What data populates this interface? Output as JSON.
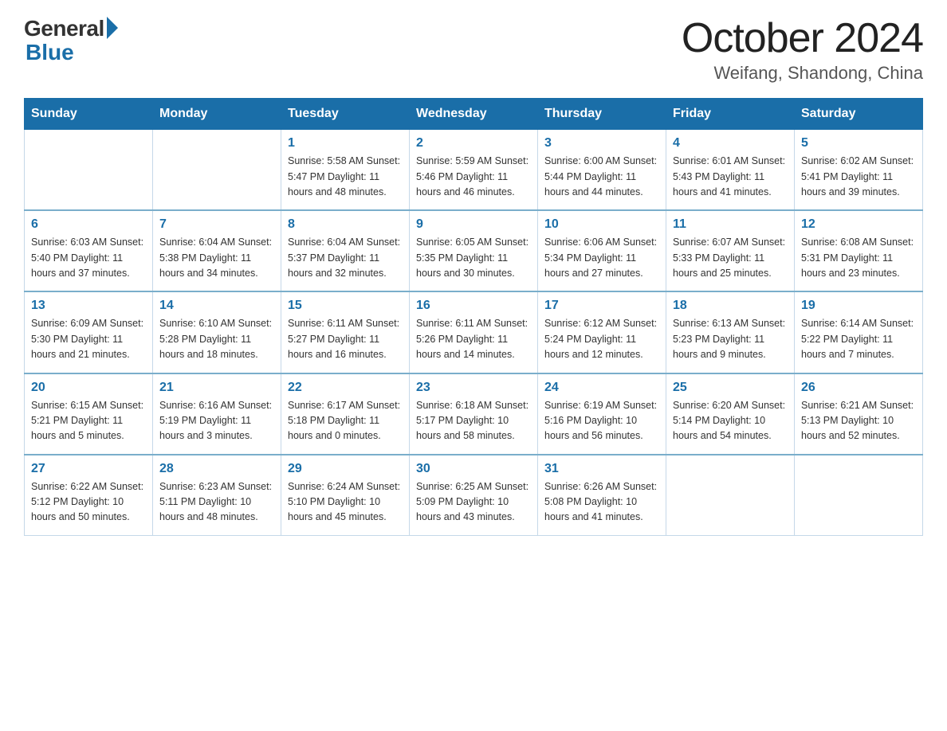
{
  "header": {
    "logo_general": "General",
    "logo_blue": "Blue",
    "month_title": "October 2024",
    "location": "Weifang, Shandong, China"
  },
  "calendar": {
    "days_of_week": [
      "Sunday",
      "Monday",
      "Tuesday",
      "Wednesday",
      "Thursday",
      "Friday",
      "Saturday"
    ],
    "weeks": [
      [
        {
          "day": "",
          "info": ""
        },
        {
          "day": "",
          "info": ""
        },
        {
          "day": "1",
          "info": "Sunrise: 5:58 AM\nSunset: 5:47 PM\nDaylight: 11 hours\nand 48 minutes."
        },
        {
          "day": "2",
          "info": "Sunrise: 5:59 AM\nSunset: 5:46 PM\nDaylight: 11 hours\nand 46 minutes."
        },
        {
          "day": "3",
          "info": "Sunrise: 6:00 AM\nSunset: 5:44 PM\nDaylight: 11 hours\nand 44 minutes."
        },
        {
          "day": "4",
          "info": "Sunrise: 6:01 AM\nSunset: 5:43 PM\nDaylight: 11 hours\nand 41 minutes."
        },
        {
          "day": "5",
          "info": "Sunrise: 6:02 AM\nSunset: 5:41 PM\nDaylight: 11 hours\nand 39 minutes."
        }
      ],
      [
        {
          "day": "6",
          "info": "Sunrise: 6:03 AM\nSunset: 5:40 PM\nDaylight: 11 hours\nand 37 minutes."
        },
        {
          "day": "7",
          "info": "Sunrise: 6:04 AM\nSunset: 5:38 PM\nDaylight: 11 hours\nand 34 minutes."
        },
        {
          "day": "8",
          "info": "Sunrise: 6:04 AM\nSunset: 5:37 PM\nDaylight: 11 hours\nand 32 minutes."
        },
        {
          "day": "9",
          "info": "Sunrise: 6:05 AM\nSunset: 5:35 PM\nDaylight: 11 hours\nand 30 minutes."
        },
        {
          "day": "10",
          "info": "Sunrise: 6:06 AM\nSunset: 5:34 PM\nDaylight: 11 hours\nand 27 minutes."
        },
        {
          "day": "11",
          "info": "Sunrise: 6:07 AM\nSunset: 5:33 PM\nDaylight: 11 hours\nand 25 minutes."
        },
        {
          "day": "12",
          "info": "Sunrise: 6:08 AM\nSunset: 5:31 PM\nDaylight: 11 hours\nand 23 minutes."
        }
      ],
      [
        {
          "day": "13",
          "info": "Sunrise: 6:09 AM\nSunset: 5:30 PM\nDaylight: 11 hours\nand 21 minutes."
        },
        {
          "day": "14",
          "info": "Sunrise: 6:10 AM\nSunset: 5:28 PM\nDaylight: 11 hours\nand 18 minutes."
        },
        {
          "day": "15",
          "info": "Sunrise: 6:11 AM\nSunset: 5:27 PM\nDaylight: 11 hours\nand 16 minutes."
        },
        {
          "day": "16",
          "info": "Sunrise: 6:11 AM\nSunset: 5:26 PM\nDaylight: 11 hours\nand 14 minutes."
        },
        {
          "day": "17",
          "info": "Sunrise: 6:12 AM\nSunset: 5:24 PM\nDaylight: 11 hours\nand 12 minutes."
        },
        {
          "day": "18",
          "info": "Sunrise: 6:13 AM\nSunset: 5:23 PM\nDaylight: 11 hours\nand 9 minutes."
        },
        {
          "day": "19",
          "info": "Sunrise: 6:14 AM\nSunset: 5:22 PM\nDaylight: 11 hours\nand 7 minutes."
        }
      ],
      [
        {
          "day": "20",
          "info": "Sunrise: 6:15 AM\nSunset: 5:21 PM\nDaylight: 11 hours\nand 5 minutes."
        },
        {
          "day": "21",
          "info": "Sunrise: 6:16 AM\nSunset: 5:19 PM\nDaylight: 11 hours\nand 3 minutes."
        },
        {
          "day": "22",
          "info": "Sunrise: 6:17 AM\nSunset: 5:18 PM\nDaylight: 11 hours\nand 0 minutes."
        },
        {
          "day": "23",
          "info": "Sunrise: 6:18 AM\nSunset: 5:17 PM\nDaylight: 10 hours\nand 58 minutes."
        },
        {
          "day": "24",
          "info": "Sunrise: 6:19 AM\nSunset: 5:16 PM\nDaylight: 10 hours\nand 56 minutes."
        },
        {
          "day": "25",
          "info": "Sunrise: 6:20 AM\nSunset: 5:14 PM\nDaylight: 10 hours\nand 54 minutes."
        },
        {
          "day": "26",
          "info": "Sunrise: 6:21 AM\nSunset: 5:13 PM\nDaylight: 10 hours\nand 52 minutes."
        }
      ],
      [
        {
          "day": "27",
          "info": "Sunrise: 6:22 AM\nSunset: 5:12 PM\nDaylight: 10 hours\nand 50 minutes."
        },
        {
          "day": "28",
          "info": "Sunrise: 6:23 AM\nSunset: 5:11 PM\nDaylight: 10 hours\nand 48 minutes."
        },
        {
          "day": "29",
          "info": "Sunrise: 6:24 AM\nSunset: 5:10 PM\nDaylight: 10 hours\nand 45 minutes."
        },
        {
          "day": "30",
          "info": "Sunrise: 6:25 AM\nSunset: 5:09 PM\nDaylight: 10 hours\nand 43 minutes."
        },
        {
          "day": "31",
          "info": "Sunrise: 6:26 AM\nSunset: 5:08 PM\nDaylight: 10 hours\nand 41 minutes."
        },
        {
          "day": "",
          "info": ""
        },
        {
          "day": "",
          "info": ""
        }
      ]
    ]
  }
}
